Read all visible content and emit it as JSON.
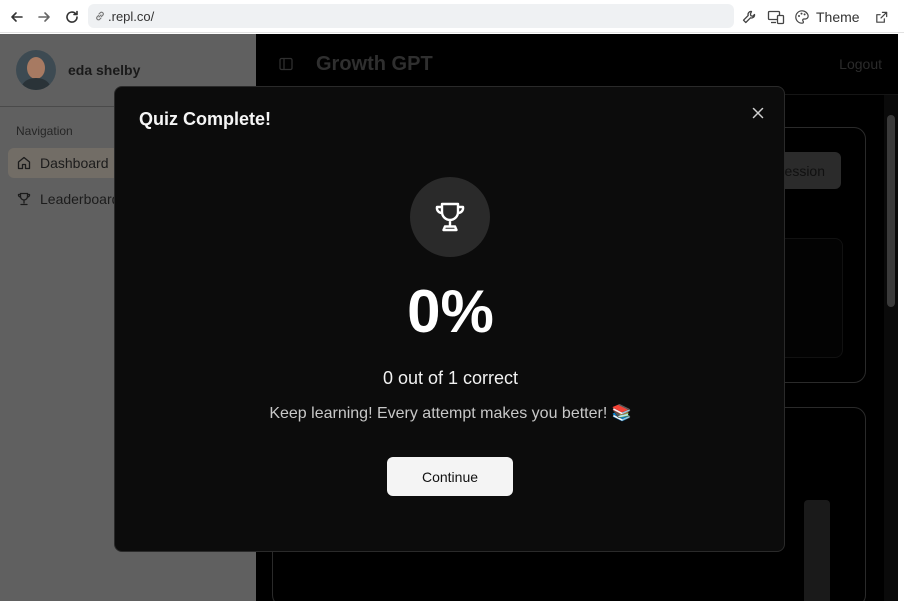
{
  "browser": {
    "url": ".repl.co/",
    "theme_label": "Theme"
  },
  "sidebar": {
    "user_name": "eda shelby",
    "nav_heading": "Navigation",
    "items": [
      {
        "label": "Dashboard",
        "icon": "home-icon",
        "active": true
      },
      {
        "label": "Leaderboard",
        "icon": "trophy-icon",
        "active": false
      }
    ]
  },
  "header": {
    "title": "Growth GPT",
    "logout_label": "Logout"
  },
  "main": {
    "session_button_label": "ession"
  },
  "modal": {
    "title": "Quiz Complete!",
    "icon": "trophy-icon",
    "score": "0%",
    "correct_text": "0 out of 1 correct",
    "message": "Keep learning! Every attempt makes you better! 📚",
    "continue_label": "Continue"
  },
  "colors": {
    "modal_bg": "#0c0c0c",
    "button_bg": "#f4f4f4",
    "sidebar_overlay": "#606060"
  }
}
